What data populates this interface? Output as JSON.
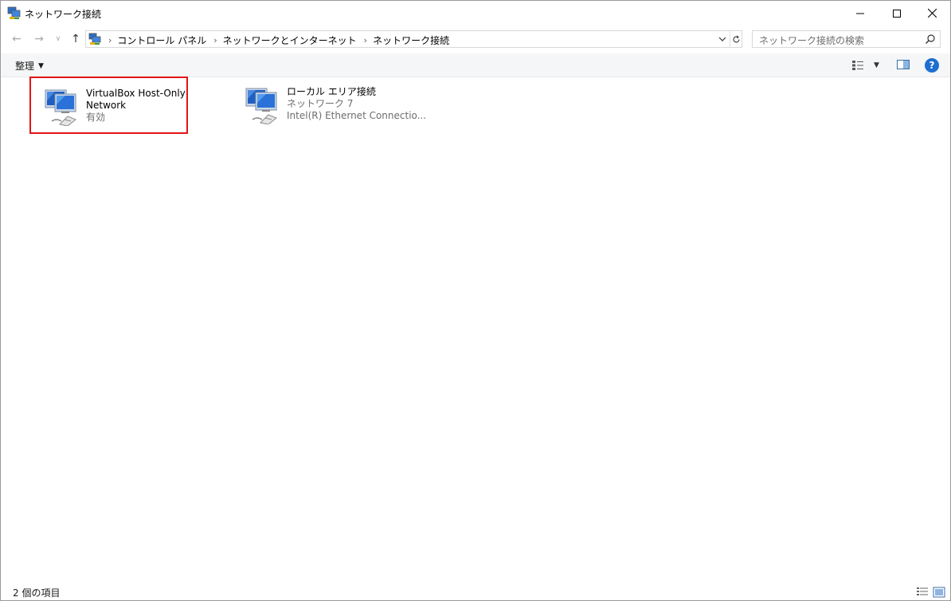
{
  "window": {
    "title": "ネットワーク接続",
    "icon": "network-connections-icon"
  },
  "controls": {
    "minimize": "minimize-icon",
    "maximize": "maximize-icon",
    "close": "close-icon"
  },
  "breadcrumbs": [
    {
      "label": "コントロール パネル"
    },
    {
      "label": "ネットワークとインターネット"
    },
    {
      "label": "ネットワーク接続"
    }
  ],
  "search": {
    "placeholder": "ネットワーク接続の検索"
  },
  "toolbar": {
    "organize_label": "整理",
    "help_label": "?"
  },
  "connections": [
    {
      "name_line1": "VirtualBox Host-Only",
      "name_line2": "Network",
      "status": "有効",
      "device": "",
      "highlighted": true
    },
    {
      "name_line1": "ローカル エリア接続",
      "name_line2": "",
      "status": "ネットワーク 7",
      "device": "Intel(R) Ethernet Connectio...",
      "highlighted": false
    }
  ],
  "statusbar": {
    "item_count": "2 個の項目"
  },
  "colors": {
    "highlight_border": "#e01515",
    "help_blue": "#1e6fd0",
    "secondary_text": "#6d6d6d"
  }
}
